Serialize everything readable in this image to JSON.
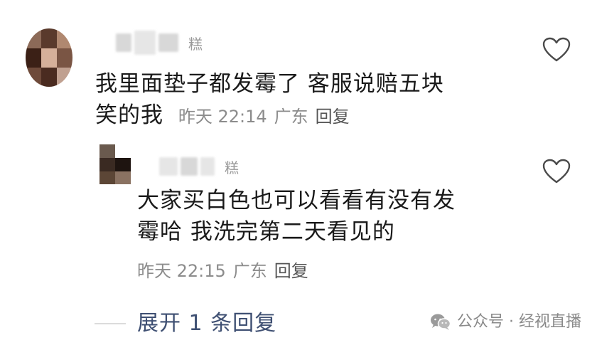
{
  "comments": [
    {
      "username_suffix": "糕",
      "text_line1": "我里面垫子都发霉了 客服说赔五块",
      "text_line2": "笑的我",
      "time": "昨天 22:14",
      "location": "广东",
      "reply_label": "回复"
    },
    {
      "username_suffix": "糕",
      "text_line1": "大家买白色也可以看看有没有发",
      "text_line2": "霉哈 我洗完第二天看见的",
      "time": "昨天 22:15",
      "location": "广东",
      "reply_label": "回复"
    }
  ],
  "expand_label": "展开 1 条回复",
  "watermark": "公众号 · 经视直播",
  "icons": {
    "like": "heart-outline-icon",
    "watermark": "wechat-icon"
  },
  "colors": {
    "text": "#1a1a1a",
    "meta": "#8c8c8c",
    "link": "#3e4f72"
  }
}
